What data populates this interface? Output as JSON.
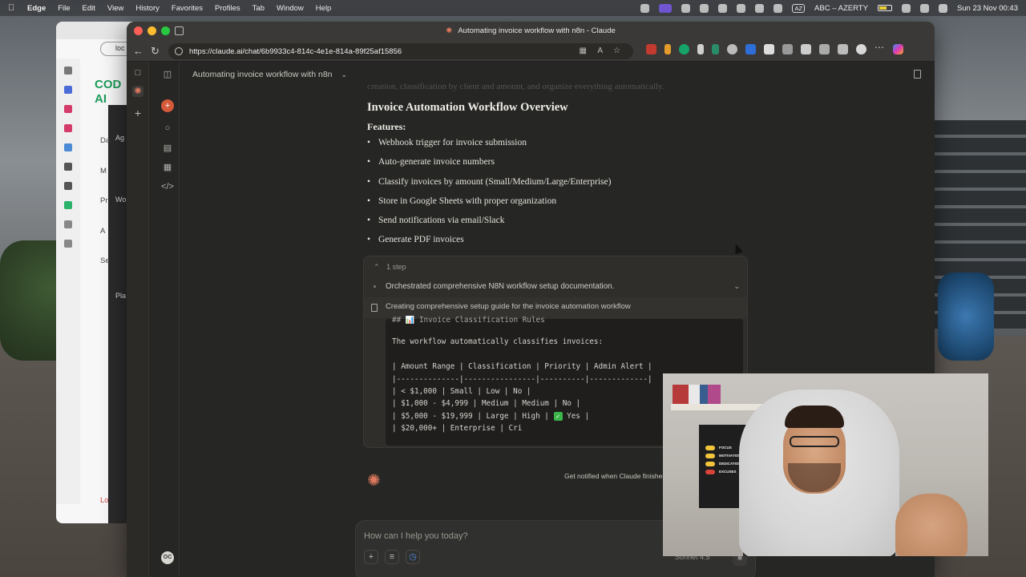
{
  "menubar": {
    "app": "Edge",
    "items": [
      "File",
      "Edit",
      "View",
      "History",
      "Favorites",
      "Profiles",
      "Tab",
      "Window",
      "Help"
    ],
    "keyboard": "AZ",
    "input_source": "ABC – AZERTY",
    "datetime": "Sun 23 Nov  00:43"
  },
  "bg_window": {
    "url": "loc",
    "logo": "COD\nAI",
    "labels": [
      "Da",
      "M",
      "Pr",
      "A",
      "Se",
      "Ag",
      "Wo",
      "Pla",
      "Lo"
    ]
  },
  "browser": {
    "tab_title": "Automating invoice workflow with n8n - Claude",
    "url": "https://claude.ai/chat/6b9933c4-814c-4e1e-814a-89f25af15856"
  },
  "app": {
    "conversation_title": "Automating invoice workflow with n8n",
    "avatar_initials": "OC",
    "faded_line": "creation, classification by client and amount, and organize everything automatically.",
    "heading": "Invoice Automation Workflow Overview",
    "features_label": "Features:",
    "features": [
      "Webhook trigger for invoice submission",
      "Auto-generate invoice numbers",
      "Classify invoices by amount (Small/Medium/Large/Enterprise)",
      "Store in Google Sheets with proper organization",
      "Send notifications via email/Slack",
      "Generate PDF invoices"
    ],
    "steps": {
      "count_label": "1 step",
      "summary": "Orchestrated comprehensive N8N workflow setup documentation.",
      "current": "Creating comprehensive setup guide for the invoice automation workflow"
    },
    "code": {
      "cut_line": "## 📊 Invoice Classification Rules",
      "intro": "The workflow automatically classifies invoices:",
      "header": "| Amount Range | Classification | Priority | Admin Alert |",
      "divider": "|--------------|----------------|----------|-------------|",
      "rows": [
        "| < $1,000 | Small | Low | No |",
        "| $1,000 - $4,999 | Medium | Medium | No |",
        "| $5,000 - $19,999 | Large | High | ",
        "| $20,000+ | Enterprise | Cri"
      ],
      "yes_label": "Yes |"
    },
    "notify_text": "Get notified when Claude finishes",
    "composer": {
      "placeholder": "How can I help you today?",
      "model": "Sonnet 4.5"
    }
  },
  "webcam": {
    "poster_lines": [
      "FOCUS",
      "MOTIVATION",
      "DEDICATION",
      "EXCUSES"
    ],
    "poster_toggles": [
      "ON",
      "ON",
      "ON",
      "OFF"
    ]
  },
  "colors": {
    "accent": "#d45a3a",
    "claude_orange": "#e07a5f",
    "background": "#262624"
  }
}
